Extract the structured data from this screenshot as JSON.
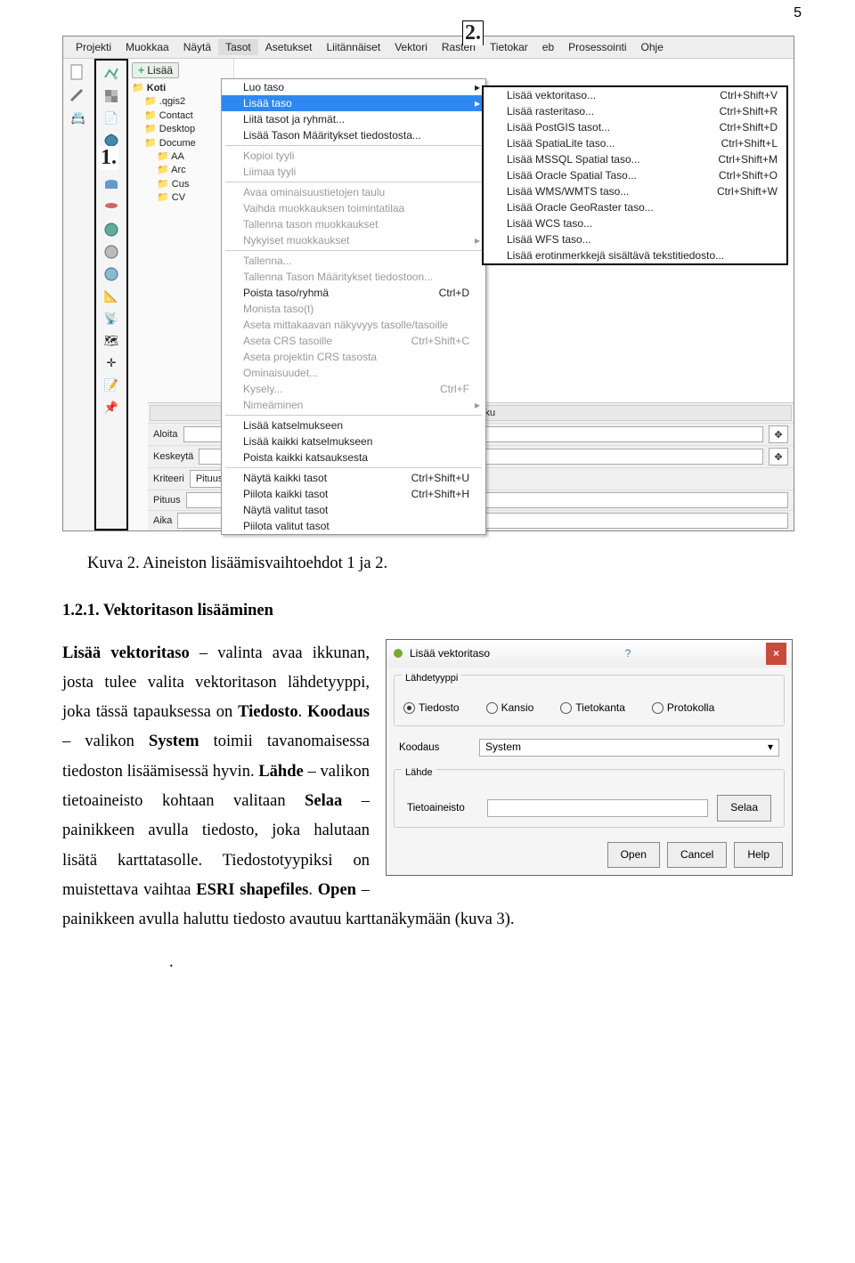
{
  "page_number": "5",
  "menubar": [
    "Projekti",
    "Muokkaa",
    "Näytä",
    "Tasot",
    "Asetukset",
    "Liitännäiset",
    "Vektori",
    "Rasteri",
    "Tietokar",
    "eb",
    "Prosessointi",
    "Ohje"
  ],
  "annot1": "1.",
  "annot2": "2.",
  "lisaa_label": "Lisää",
  "tree_root": "Koti",
  "tree_items": [
    ".qgis2",
    "Contact",
    "Desktop",
    "Docume",
    "AA",
    "Arc",
    "Cus",
    "CV"
  ],
  "menu_items": [
    {
      "label": "Luo taso",
      "class": "arrow"
    },
    {
      "label": "Lisää taso",
      "class": "sel arrow"
    },
    {
      "label": "Liitä tasot ja ryhmät...",
      "class": ""
    },
    {
      "label": "Lisää Tason Määritykset tiedostosta...",
      "class": ""
    },
    {
      "sep": true
    },
    {
      "label": "Kopioi tyyli",
      "class": "disabled"
    },
    {
      "label": "Liimaa tyyli",
      "class": "disabled"
    },
    {
      "sep": true
    },
    {
      "label": "Avaa ominaisuustietojen taulu",
      "class": "disabled"
    },
    {
      "label": "Vaihda muokkauksen toimintatilaa",
      "class": "disabled"
    },
    {
      "label": "Tallenna tason muokkaukset",
      "class": "disabled"
    },
    {
      "label": "Nykyiset muokkaukset",
      "class": "disabled arrow"
    },
    {
      "sep": true
    },
    {
      "label": "Tallenna...",
      "class": "disabled"
    },
    {
      "label": "Tallenna Tason Määritykset tiedostoon...",
      "class": "disabled"
    },
    {
      "label": "Poista taso/ryhmä",
      "short": "Ctrl+D"
    },
    {
      "label": "Monista taso(t)",
      "class": "disabled"
    },
    {
      "label": "Aseta mittakaavan näkyvyys tasolle/tasoille",
      "class": "disabled"
    },
    {
      "label": "Aseta CRS tasoille",
      "short": "Ctrl+Shift+C",
      "class": "disabled"
    },
    {
      "label": "Aseta projektin CRS tasosta",
      "class": "disabled"
    },
    {
      "label": "Ominaisuudet...",
      "class": "disabled"
    },
    {
      "label": "Kysely...",
      "short": "Ctrl+F",
      "class": "disabled"
    },
    {
      "label": "Nimeäminen",
      "class": "disabled arrow"
    },
    {
      "sep": true
    },
    {
      "label": "Lisää katselmukseen",
      "class": ""
    },
    {
      "label": "Lisää kaikki katselmukseen",
      "class": ""
    },
    {
      "label": "Poista kaikki katsauksesta",
      "class": ""
    },
    {
      "sep": true
    },
    {
      "label": "Näytä kaikki tasot",
      "short": "Ctrl+Shift+U"
    },
    {
      "label": "Piilota kaikki tasot",
      "short": "Ctrl+Shift+H"
    },
    {
      "label": "Näytä valitut tasot",
      "class": ""
    },
    {
      "label": "Piilota valitut tasot",
      "class": ""
    }
  ],
  "submenu": [
    {
      "label": "Lisää vektoritaso...",
      "short": "Ctrl+Shift+V"
    },
    {
      "label": "Lisää rasteritaso...",
      "short": "Ctrl+Shift+R"
    },
    {
      "label": "Lisää PostGIS tasot...",
      "short": "Ctrl+Shift+D"
    },
    {
      "label": "Lisää SpatiaLite taso...",
      "short": "Ctrl+Shift+L"
    },
    {
      "label": "Lisää MSSQL Spatial taso...",
      "short": "Ctrl+Shift+M"
    },
    {
      "label": "Lisää Oracle Spatial Taso...",
      "short": "Ctrl+Shift+O"
    },
    {
      "label": "Lisää WMS/WMTS taso...",
      "short": "Ctrl+Shift+W"
    },
    {
      "label": "Lisää Oracle GeoRaster taso...",
      "short": ""
    },
    {
      "label": "Lisää WCS taso...",
      "short": ""
    },
    {
      "label": "Lisää WFS taso...",
      "short": ""
    },
    {
      "label": "Lisää erotinmerkkejä sisältävä tekstitiedosto...",
      "short": ""
    }
  ],
  "panel": {
    "title": "Lyhin polku",
    "rows": [
      "Aloita",
      "Keskeytä",
      "Kriteeri",
      "Pituus",
      "Aika"
    ],
    "kriteeri_val": "Pituus"
  },
  "caption1": "Kuva 2. Aineiston lisäämisvaihtoehdot 1 ja 2.",
  "heading": "1.2.1. Vektoritason lisääminen",
  "para1_parts": {
    "a": "Lisää vektoritaso",
    "b": " – valinta avaa ikkunan, josta tulee valita vektoritason lähdetyyppi, joka tässä tapauksessa on ",
    "c": "Tiedosto",
    "d": ". ",
    "e": "Koodaus",
    "f": " – valikon ",
    "g": "System",
    "h": " toimii tavanomaisessa tiedoston lisäämisessä hyvin. ",
    "i": "Lähde",
    "j": " – valikon tietoaineisto kohtaan valitaan ",
    "k": "Selaa",
    "l": " – painikkeen avulla tiedosto, joka halutaan lisätä karttatasolle. Tiedostotyypiksi on muistettava vaihtaa ",
    "m": "ESRI shapefiles",
    "n": ". ",
    "o": "Open",
    "p": " – painikkeen avulla haluttu tiedosto avautuu karttanäkymään (kuva 3)."
  },
  "dialog": {
    "title": "Lisää vektoritaso",
    "group1": "Lähdetyyppi",
    "radios": [
      "Tiedosto",
      "Kansio",
      "Tietokanta",
      "Protokolla"
    ],
    "koodaus_label": "Koodaus",
    "koodaus_value": "System",
    "group2": "Lähde",
    "tieto_label": "Tietoaineisto",
    "selaa": "Selaa",
    "buttons": [
      "Open",
      "Cancel",
      "Help"
    ]
  },
  "dot": "."
}
